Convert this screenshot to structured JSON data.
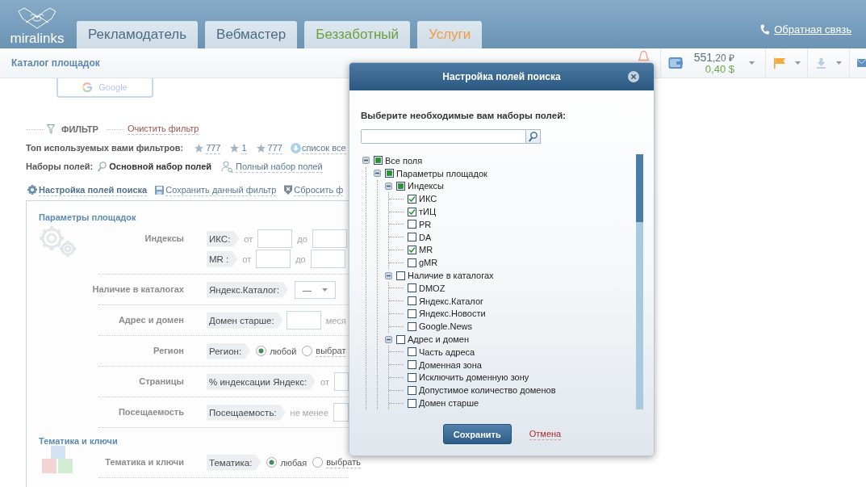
{
  "header": {
    "logo_text": "miralinks",
    "tabs": [
      {
        "label": "Рекламодатель",
        "selected": false,
        "color": "#4e6a84"
      },
      {
        "label": "Вебмастер",
        "selected": false,
        "color": "#4e6a84"
      },
      {
        "label": "Беззаботный",
        "selected": false,
        "color": "#6b9f3f"
      },
      {
        "label": "Услуги",
        "selected": false,
        "color": "#f29a3d"
      }
    ],
    "feedback_link": "Обратная связь"
  },
  "subheader": {
    "title": "Каталог площадок",
    "balance": {
      "rub_whole": "551",
      "rub_fraction": ",20 ₽",
      "usd": "0,40 $"
    }
  },
  "google_button": {
    "label": "Google"
  },
  "filter": {
    "title": "ФИЛЬТР",
    "clear_link": "Очистить фильтр",
    "top_label": "Топ используемых вами фильтров:",
    "top_filters": [
      "777",
      "1",
      "777"
    ],
    "all_link": "список все",
    "sets_label": "Наборы полей:",
    "sets": [
      {
        "label": "Основной набор полей",
        "selected": true,
        "kind": "basic"
      },
      {
        "label": "Полный набор полей",
        "selected": false,
        "kind": "full"
      }
    ],
    "actions": [
      {
        "label": "Настройка полей поиска",
        "selected": true,
        "kind": "settings"
      },
      {
        "label": "Сохранить данный фильтр",
        "selected": false,
        "kind": "save"
      },
      {
        "label": "Сбросить ф",
        "selected": false,
        "kind": "reset"
      }
    ]
  },
  "form": {
    "sections": [
      {
        "title": "Параметры площадок",
        "kind": "gears",
        "rows": [
          {
            "label": "Индексы",
            "lines": [
              [
                {
                  "kind": "tag",
                  "text": "ИКС:"
                },
                {
                  "kind": "text",
                  "text": "от"
                },
                {
                  "kind": "input"
                },
                {
                  "kind": "text",
                  "text": "до"
                },
                {
                  "kind": "input"
                }
              ],
              [
                {
                  "kind": "tag",
                  "text": "MR :"
                },
                {
                  "kind": "text",
                  "text": "от"
                },
                {
                  "kind": "input"
                },
                {
                  "kind": "text",
                  "text": "до"
                },
                {
                  "kind": "input"
                }
              ]
            ]
          },
          {
            "label": "Наличие в каталогах",
            "lines": [
              [
                {
                  "kind": "tag",
                  "text": "Яндекс.Каталог:"
                },
                {
                  "kind": "select",
                  "value": "—"
                }
              ]
            ]
          },
          {
            "label": "Адрес и домен",
            "lines": [
              [
                {
                  "kind": "tag",
                  "text": "Домен старше:"
                },
                {
                  "kind": "input"
                },
                {
                  "kind": "text",
                  "text": "меся"
                }
              ]
            ]
          },
          {
            "label": "Регион",
            "lines": [
              [
                {
                  "kind": "tag",
                  "text": "Регион:"
                },
                {
                  "kind": "radio",
                  "text": "любой",
                  "selected": true
                },
                {
                  "kind": "radio",
                  "text": "выбрат",
                  "selected": false
                }
              ]
            ]
          },
          {
            "label": "Страницы",
            "lines": [
              [
                {
                  "kind": "tag",
                  "text": "% индексации Яндекс:"
                },
                {
                  "kind": "text",
                  "text": "от"
                },
                {
                  "kind": "input"
                }
              ]
            ]
          },
          {
            "label": "Посещаемость",
            "lines": [
              [
                {
                  "kind": "tag",
                  "text": "Посещаемость:"
                },
                {
                  "kind": "text",
                  "text": "не менее"
                },
                {
                  "kind": "input"
                }
              ]
            ]
          }
        ]
      },
      {
        "title": "Тематика и ключи",
        "kind": "cubes",
        "rows": [
          {
            "label": "Тематика и ключи",
            "lines": [
              [
                {
                  "kind": "tag",
                  "text": "Тематика:"
                },
                {
                  "kind": "radio",
                  "text": "любая",
                  "selected": true
                },
                {
                  "kind": "radio",
                  "text": "выбрать",
                  "selected": false
                }
              ]
            ]
          }
        ]
      }
    ]
  },
  "dialog": {
    "title": "Настройка полей поиска",
    "prompt": "Выберите необходимые вам наборы полей:",
    "tree": [
      {
        "label": "Все поля",
        "checked": false,
        "partial": true,
        "expanded": true,
        "children": [
          {
            "label": "Параметры площадок",
            "checked": false,
            "partial": true,
            "expanded": true,
            "children": [
              {
                "label": "Индексы",
                "checked": false,
                "partial": true,
                "expanded": true,
                "children": [
                  {
                    "label": "ИКС",
                    "checked": true,
                    "partial": false
                  },
                  {
                    "label": "тИЦ",
                    "checked": true,
                    "partial": false
                  },
                  {
                    "label": "PR",
                    "checked": false,
                    "partial": false
                  },
                  {
                    "label": "DA",
                    "checked": false,
                    "partial": false
                  },
                  {
                    "label": "MR",
                    "checked": true,
                    "partial": false
                  },
                  {
                    "label": "gMR",
                    "checked": false,
                    "partial": false
                  }
                ]
              },
              {
                "label": "Наличие в каталогах",
                "checked": false,
                "partial": false,
                "expanded": true,
                "children": [
                  {
                    "label": "DMOZ",
                    "checked": false,
                    "partial": false
                  },
                  {
                    "label": "Яндекс.Каталог",
                    "checked": false,
                    "partial": false
                  },
                  {
                    "label": "Яндекс.Новости",
                    "checked": false,
                    "partial": false
                  },
                  {
                    "label": "Google.News",
                    "checked": false,
                    "partial": false
                  }
                ]
              },
              {
                "label": "Адрес и домен",
                "checked": false,
                "partial": false,
                "expanded": true,
                "children": [
                  {
                    "label": "Часть адреса",
                    "checked": false,
                    "partial": false
                  },
                  {
                    "label": "Доменная зона",
                    "checked": false,
                    "partial": false
                  },
                  {
                    "label": "Исключить доменную зону",
                    "checked": false,
                    "partial": false
                  },
                  {
                    "label": "Допустимое количество доменов",
                    "checked": false,
                    "partial": false
                  },
                  {
                    "label": "Домен старше",
                    "checked": false,
                    "partial": false
                  }
                ]
              }
            ]
          }
        ]
      }
    ],
    "save_button": "Сохранить",
    "cancel_link": "Отмена"
  }
}
